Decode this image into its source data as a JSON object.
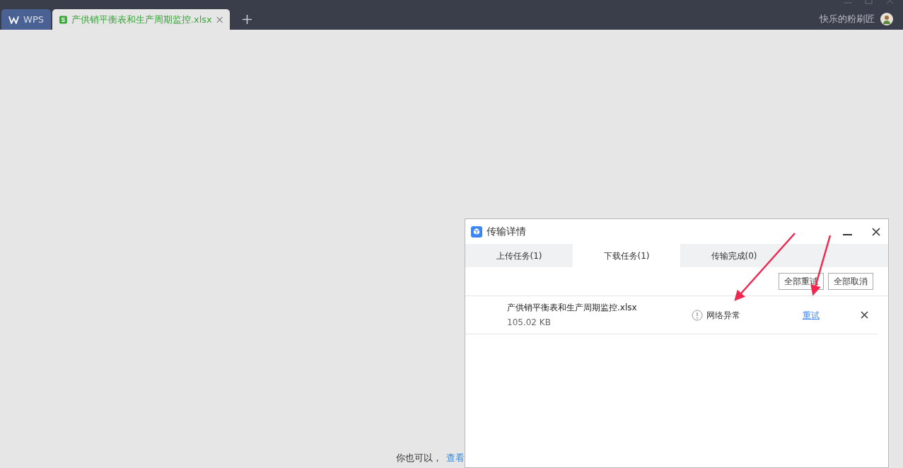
{
  "tabs": [
    {
      "kind": "home",
      "label": "WPS",
      "selected": false
    },
    {
      "kind": "document",
      "label": "产供销平衡表和生产周期监控.xlsx",
      "selected": true
    }
  ],
  "user": {
    "name": "快乐的粉刷匠"
  },
  "footer": {
    "text": "你也可以，",
    "link": "查看"
  },
  "dialog": {
    "title": "传输详情",
    "tabs": [
      {
        "label": "上传任务(1)",
        "selected": false
      },
      {
        "label": "下载任务(1)",
        "selected": true
      },
      {
        "label": "传输完成(0)",
        "selected": false
      }
    ],
    "actions": [
      "全部重试",
      "全部取消"
    ],
    "tasks": [
      {
        "name": "产供销平衡表和生产周期监控.xlsx",
        "size": "105.02 KB",
        "status": "网络异常",
        "action": "重试"
      }
    ]
  }
}
